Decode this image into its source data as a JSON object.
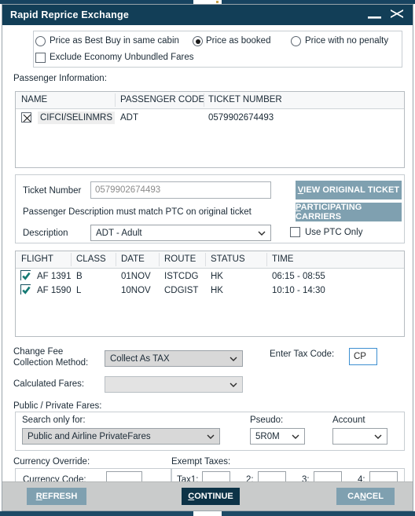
{
  "window": {
    "title": "Rapid Reprice Exchange",
    "minimize_icon": "minimize-icon",
    "close_icon": "close-icon"
  },
  "pricing_options": {
    "radios": [
      {
        "label": "Price as Best Buy in same cabin",
        "checked": false
      },
      {
        "label": "Price as booked",
        "checked": true
      },
      {
        "label": "Price with no penalty",
        "checked": false
      }
    ],
    "exclude_checkbox": {
      "label": "Exclude Economy Unbundled Fares",
      "checked": false
    }
  },
  "passenger_section": {
    "heading": "Passenger Information:",
    "columns": [
      "NAME",
      "PASSENGER CODE",
      "TICKET NUMBER"
    ],
    "rows": [
      {
        "checked": true,
        "name": "CIFCI/SELINMRS",
        "passenger_code": "ADT",
        "ticket_number": "0579902674493"
      }
    ]
  },
  "ticket_section": {
    "ticket_number_label": "Ticket Number",
    "ticket_number_value": "0579902674493",
    "note": "Passenger Description must match PTC on original ticket",
    "description_label": "Description",
    "description_value": "ADT - Adult",
    "view_original_ticket": "VIEW ORIGINAL TICKET",
    "view_original_ticket_accel": "V",
    "participating_carriers": "PARTICIPATING CARRIERS",
    "participating_carriers_accel": "P",
    "use_ptc_only": {
      "label": "Use PTC Only",
      "checked": false
    }
  },
  "flight_section": {
    "columns": [
      "FLIGHT",
      "CLASS",
      "DATE",
      "ROUTE",
      "STATUS",
      "TIME"
    ],
    "rows": [
      {
        "checked": true,
        "flight": "AF 1391",
        "class": "B",
        "date": "01NOV",
        "route": "ISTCDG",
        "status": "HK",
        "time": "06:15 - 08:55"
      },
      {
        "checked": true,
        "flight": "AF 1590",
        "class": "L",
        "date": "10NOV",
        "route": "CDGIST",
        "status": "HK",
        "time": "10:10 - 14:30"
      }
    ]
  },
  "change_fee": {
    "label_line1": "Change Fee",
    "label_line2": "Collection Method:",
    "method_value": "Collect As TAX",
    "calculated_fares_label": "Calculated Fares:",
    "calculated_fares_value": "",
    "tax_code_label": "Enter Tax Code:",
    "tax_code_value": "CP"
  },
  "fares": {
    "heading": "Public / Private Fares:",
    "search_only_for_label": "Search only for:",
    "search_only_for_value": "Public and Airline PrivateFares",
    "pseudo_label": "Pseudo:",
    "pseudo_value": "5R0M",
    "account_label": "Account",
    "account_value": ""
  },
  "currency": {
    "override_heading": "Currency Override:",
    "currency_code_label": "Currency Code:",
    "currency_code_value": "",
    "exempt_heading": "Exempt Taxes:",
    "taxes": [
      {
        "label": "Tax1:",
        "value": ""
      },
      {
        "label": "2:",
        "value": ""
      },
      {
        "label": "3:",
        "value": ""
      },
      {
        "label": "4:",
        "value": ""
      }
    ]
  },
  "footer": {
    "refresh": {
      "label": "REFRESH",
      "accel": "R"
    },
    "continue": {
      "label": "CONTINUE",
      "accel": "C"
    },
    "cancel": {
      "label": "CANCEL",
      "accel": "N"
    }
  },
  "colors": {
    "titlebar": "#123e57",
    "teal_button": "#7fa0b0",
    "continue_button": "#0d3347",
    "footer_bg": "#c9cbcb",
    "check_teal": "#14505f",
    "focus_blue": "#3d8fd1"
  }
}
